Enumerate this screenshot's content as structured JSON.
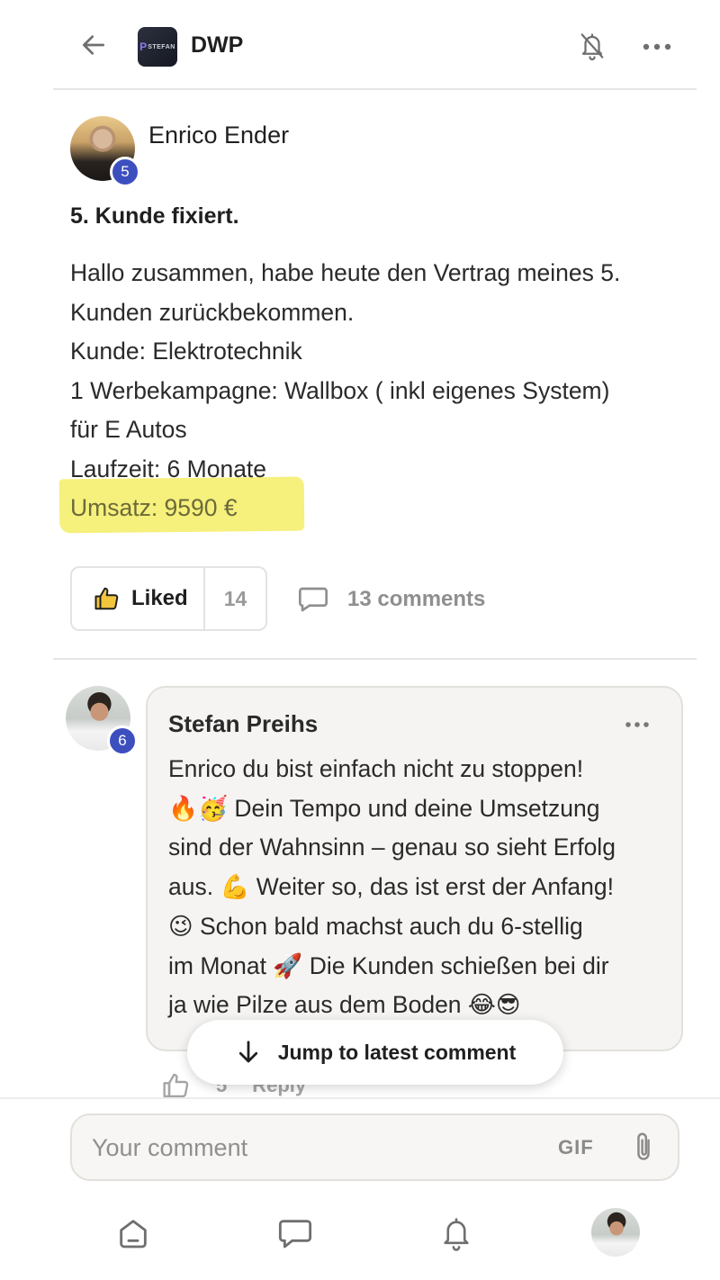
{
  "header": {
    "group_logo_text": "STEFAN",
    "group_name": "DWP",
    "icons": [
      "arrow-left-icon",
      "bell-off-icon",
      "more-horizontal-icon"
    ]
  },
  "post": {
    "author": {
      "name": "Enrico Ender",
      "level": "5"
    },
    "title": "5. Kunde fixiert.",
    "body_lines": [
      "Hallo zusammen, habe heute den Vertrag meines 5.",
      "Kunden zurückbekommen.",
      "Kunde: Elektrotechnik",
      "1 Werbekampagne: Wallbox ( inkl eigenes System)",
      "für E Autos",
      "Laufzeit: 6 Monate",
      "Umsatz: 9590 €"
    ],
    "highlight_color": "#f6f07c",
    "like_label": "Liked",
    "like_count": "14",
    "comments_label": "13 comments"
  },
  "comment": {
    "author": {
      "name": "Stefan Preihs",
      "level": "6"
    },
    "body_lines": [
      "Enrico du bist einfach nicht zu stoppen!",
      "🔥🥳 Dein Tempo und deine Umsetzung",
      "sind der Wahnsinn – genau so sieht Erfolg",
      "aus. 💪 Weiter so, das ist erst der Anfang!",
      "😉 Schon bald machst auch du 6-stellig",
      "im Monat 🚀 Die Kunden schießen bei dir",
      "ja wie Pilze aus dem Boden 😂😎"
    ],
    "like_count": "5",
    "reply_label": "Reply"
  },
  "jump_button": {
    "label": "Jump to latest comment"
  },
  "composer": {
    "placeholder": "Your comment",
    "gif_label": "GIF"
  },
  "colors": {
    "badge": "#3d4fbf",
    "muted_text": "#8f8f8f",
    "bubble_bg": "#f5f4f2"
  }
}
